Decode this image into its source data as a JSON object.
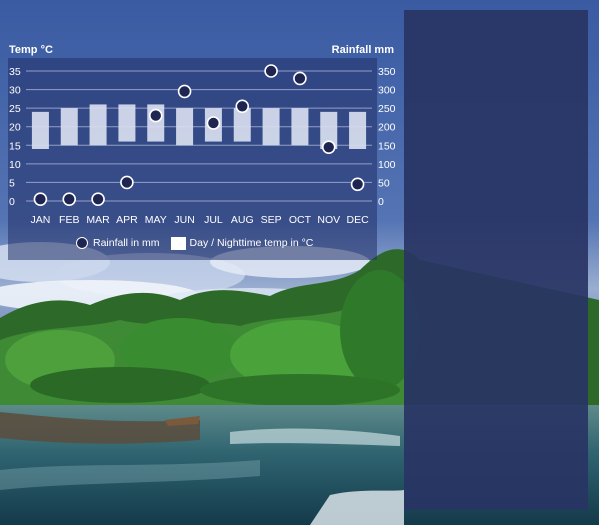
{
  "chart_data": {
    "type": "bar",
    "categories": [
      "JAN",
      "FEB",
      "MAR",
      "APR",
      "MAY",
      "JUN",
      "JUL",
      "AUG",
      "SEP",
      "OCT",
      "NOV",
      "DEC"
    ],
    "series": [
      {
        "name": "Day / Nighttime temp in °C",
        "kind": "range-bar",
        "low": [
          14,
          15,
          15,
          16,
          16,
          15,
          16,
          16,
          15,
          15,
          14,
          14
        ],
        "high": [
          24,
          25,
          26,
          26,
          26,
          25,
          25,
          25,
          25,
          25,
          24,
          24
        ]
      },
      {
        "name": "Rainfall in mm",
        "kind": "marker",
        "axis": "right",
        "values": [
          5,
          5,
          5,
          50,
          230,
          295,
          210,
          255,
          350,
          330,
          145,
          45
        ]
      }
    ],
    "left_axis": {
      "title": "Temp °C",
      "ticks": [
        35,
        30,
        25,
        20,
        15,
        10,
        5,
        0
      ],
      "range": [
        0,
        35
      ]
    },
    "right_axis": {
      "title": "Rainfall mm",
      "ticks": [
        350,
        300,
        250,
        200,
        150,
        100,
        50,
        0
      ],
      "range": [
        0,
        350
      ]
    },
    "grid": true,
    "legend_position": "bottom"
  },
  "legend": {
    "rain_label": "Rainfall in mm",
    "temp_label": "Day / Nighttime temp in °C"
  },
  "colors": {
    "sky_top": "#3b5aa0",
    "panel_overlay": "#283464",
    "temp_bar": "#d8def0",
    "marker_fill": "#1d2550",
    "marker_stroke": "#ffffff",
    "gridline": "#aab6d8"
  }
}
